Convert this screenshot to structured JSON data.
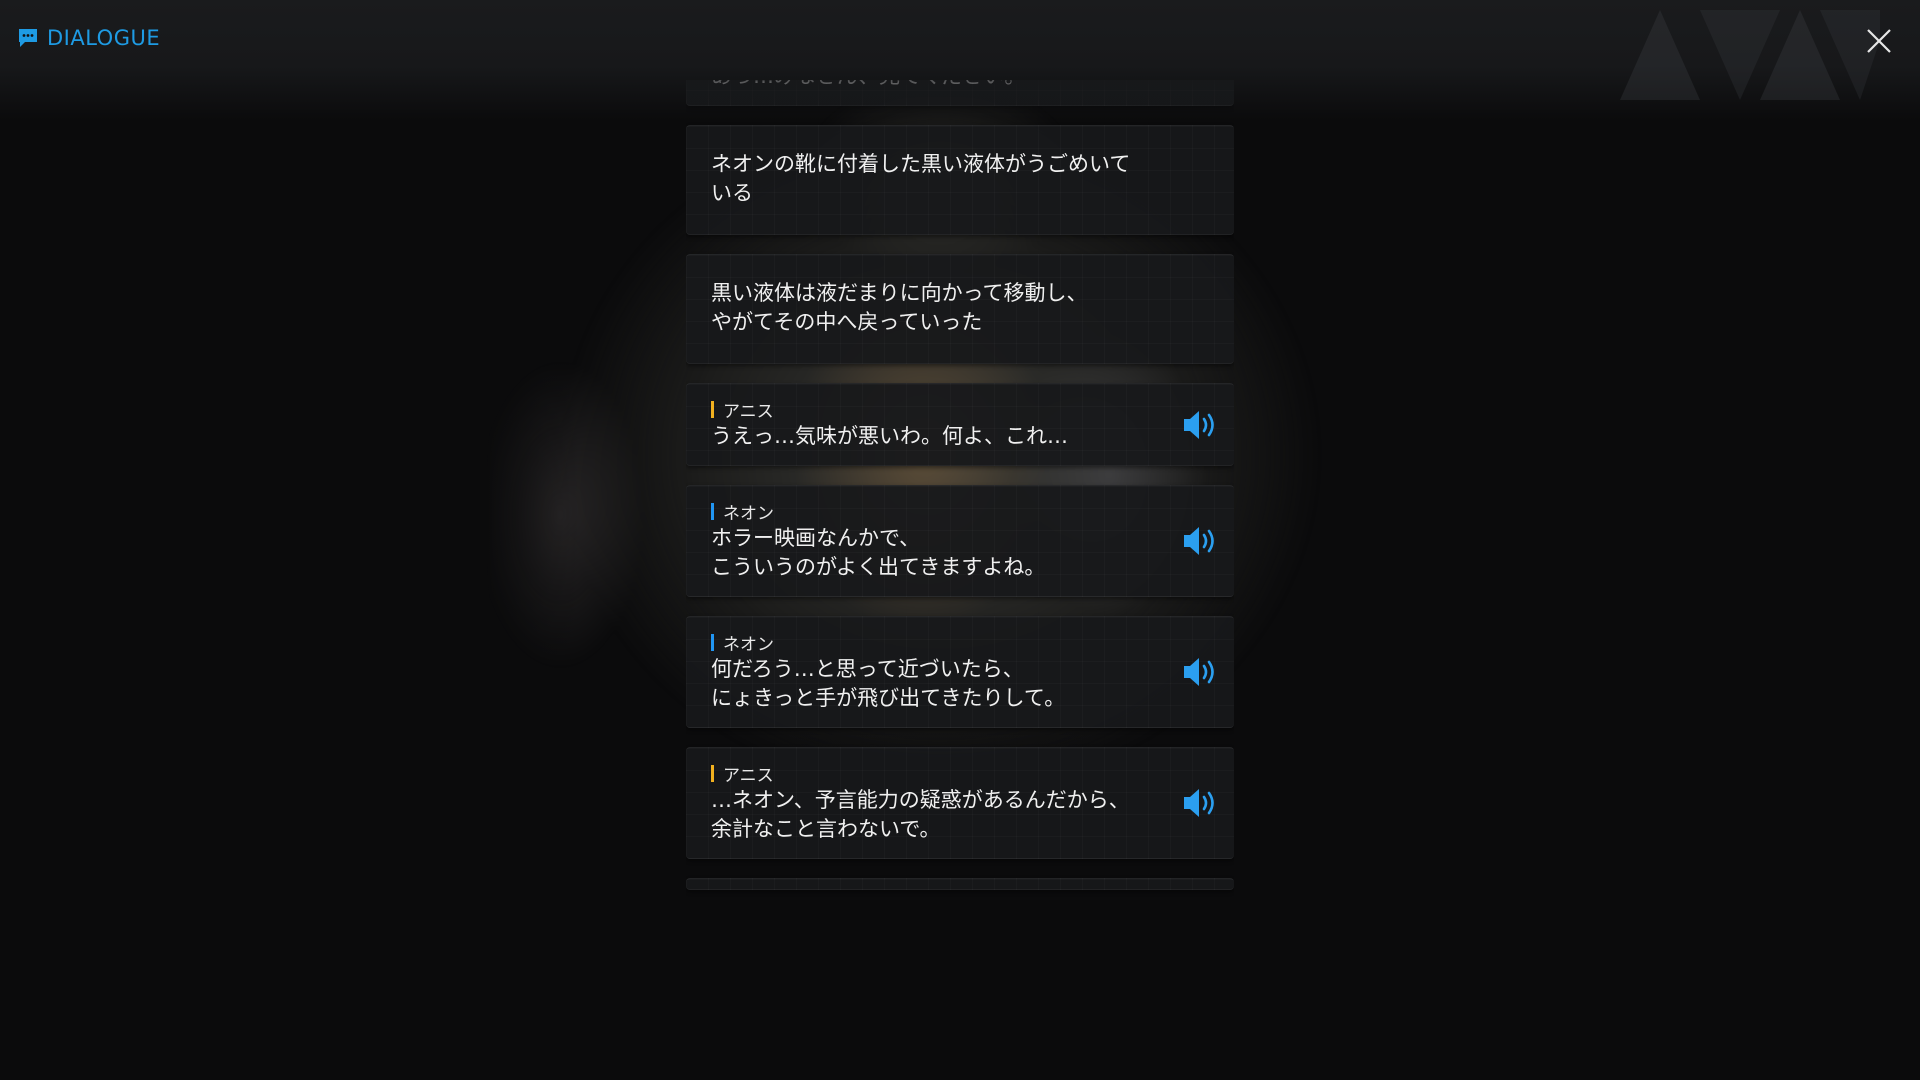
{
  "header": {
    "title": "DIALOGUE",
    "title_icon": "chat-bubble-icon",
    "close_icon": "close-x-icon",
    "accent_color": "#1e9be4"
  },
  "log": {
    "speaker_colors": {
      "ネオン": "#2196f3",
      "アニス": "#f2b11f"
    },
    "entries": [
      {
        "type": "dialog",
        "speaker": "ネオン",
        "text": "あっ…みなさん、見てください。",
        "voice_icon": "speaker-icon"
      },
      {
        "type": "narration",
        "text": "ネオンの靴に付着した黒い液体がうごめいている"
      },
      {
        "type": "narration",
        "text": "黒い液体は液だまりに向かって移動し、\nやがてその中へ戻っていった"
      },
      {
        "type": "dialog",
        "speaker": "アニス",
        "text": "うえっ…気味が悪いわ。何よ、これ…",
        "voice_icon": "speaker-icon"
      },
      {
        "type": "dialog",
        "speaker": "ネオン",
        "text": "ホラー映画なんかで、\nこういうのがよく出てきますよね。",
        "voice_icon": "speaker-icon"
      },
      {
        "type": "dialog",
        "speaker": "ネオン",
        "text": "何だろう…と思って近づいたら、\nにょきっと手が飛び出てきたりして。",
        "voice_icon": "speaker-icon"
      },
      {
        "type": "dialog",
        "speaker": "アニス",
        "text": "…ネオン、予言能力の疑惑があるんだから、\n余計なこと言わないで。",
        "voice_icon": "speaker-icon"
      }
    ]
  }
}
